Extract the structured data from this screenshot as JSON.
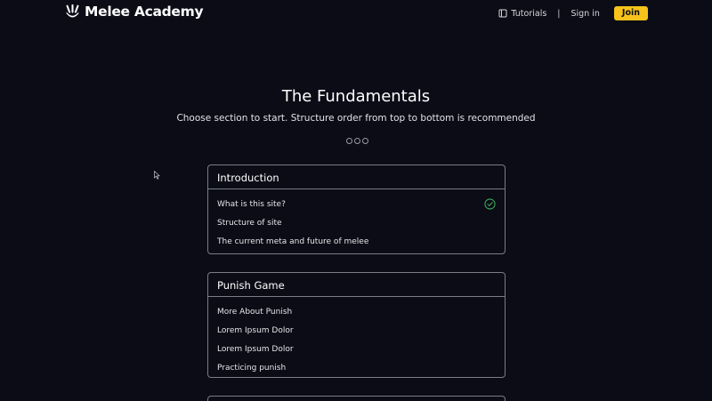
{
  "nav": {
    "brand": "Melee Academy",
    "tutorials": "Tutorials",
    "separator": "|",
    "signin": "Sign in",
    "join": "Join",
    "accent_color": "#f6c21b"
  },
  "hero": {
    "title": "The Fundamentals",
    "subtitle": "Choose section to start. Structure order from top to bottom is recommended",
    "pager_dots": 3
  },
  "sections": [
    {
      "title": "Introduction",
      "items": [
        {
          "label": "What is this site?",
          "completed": true
        },
        {
          "label": "Structure of site",
          "completed": false
        },
        {
          "label": "The current meta and future of melee",
          "completed": false
        }
      ]
    },
    {
      "title": "Punish Game",
      "items": [
        {
          "label": "More About Punish",
          "completed": false
        },
        {
          "label": "Lorem Ipsum Dolor",
          "completed": false
        },
        {
          "label": "Lorem Ipsum Dolor",
          "completed": false
        },
        {
          "label": "Practicing punish",
          "completed": false
        }
      ]
    }
  ],
  "colors": {
    "background": "#0b0c16",
    "card_border": "#7a7c88",
    "check": "#3fae5c"
  }
}
